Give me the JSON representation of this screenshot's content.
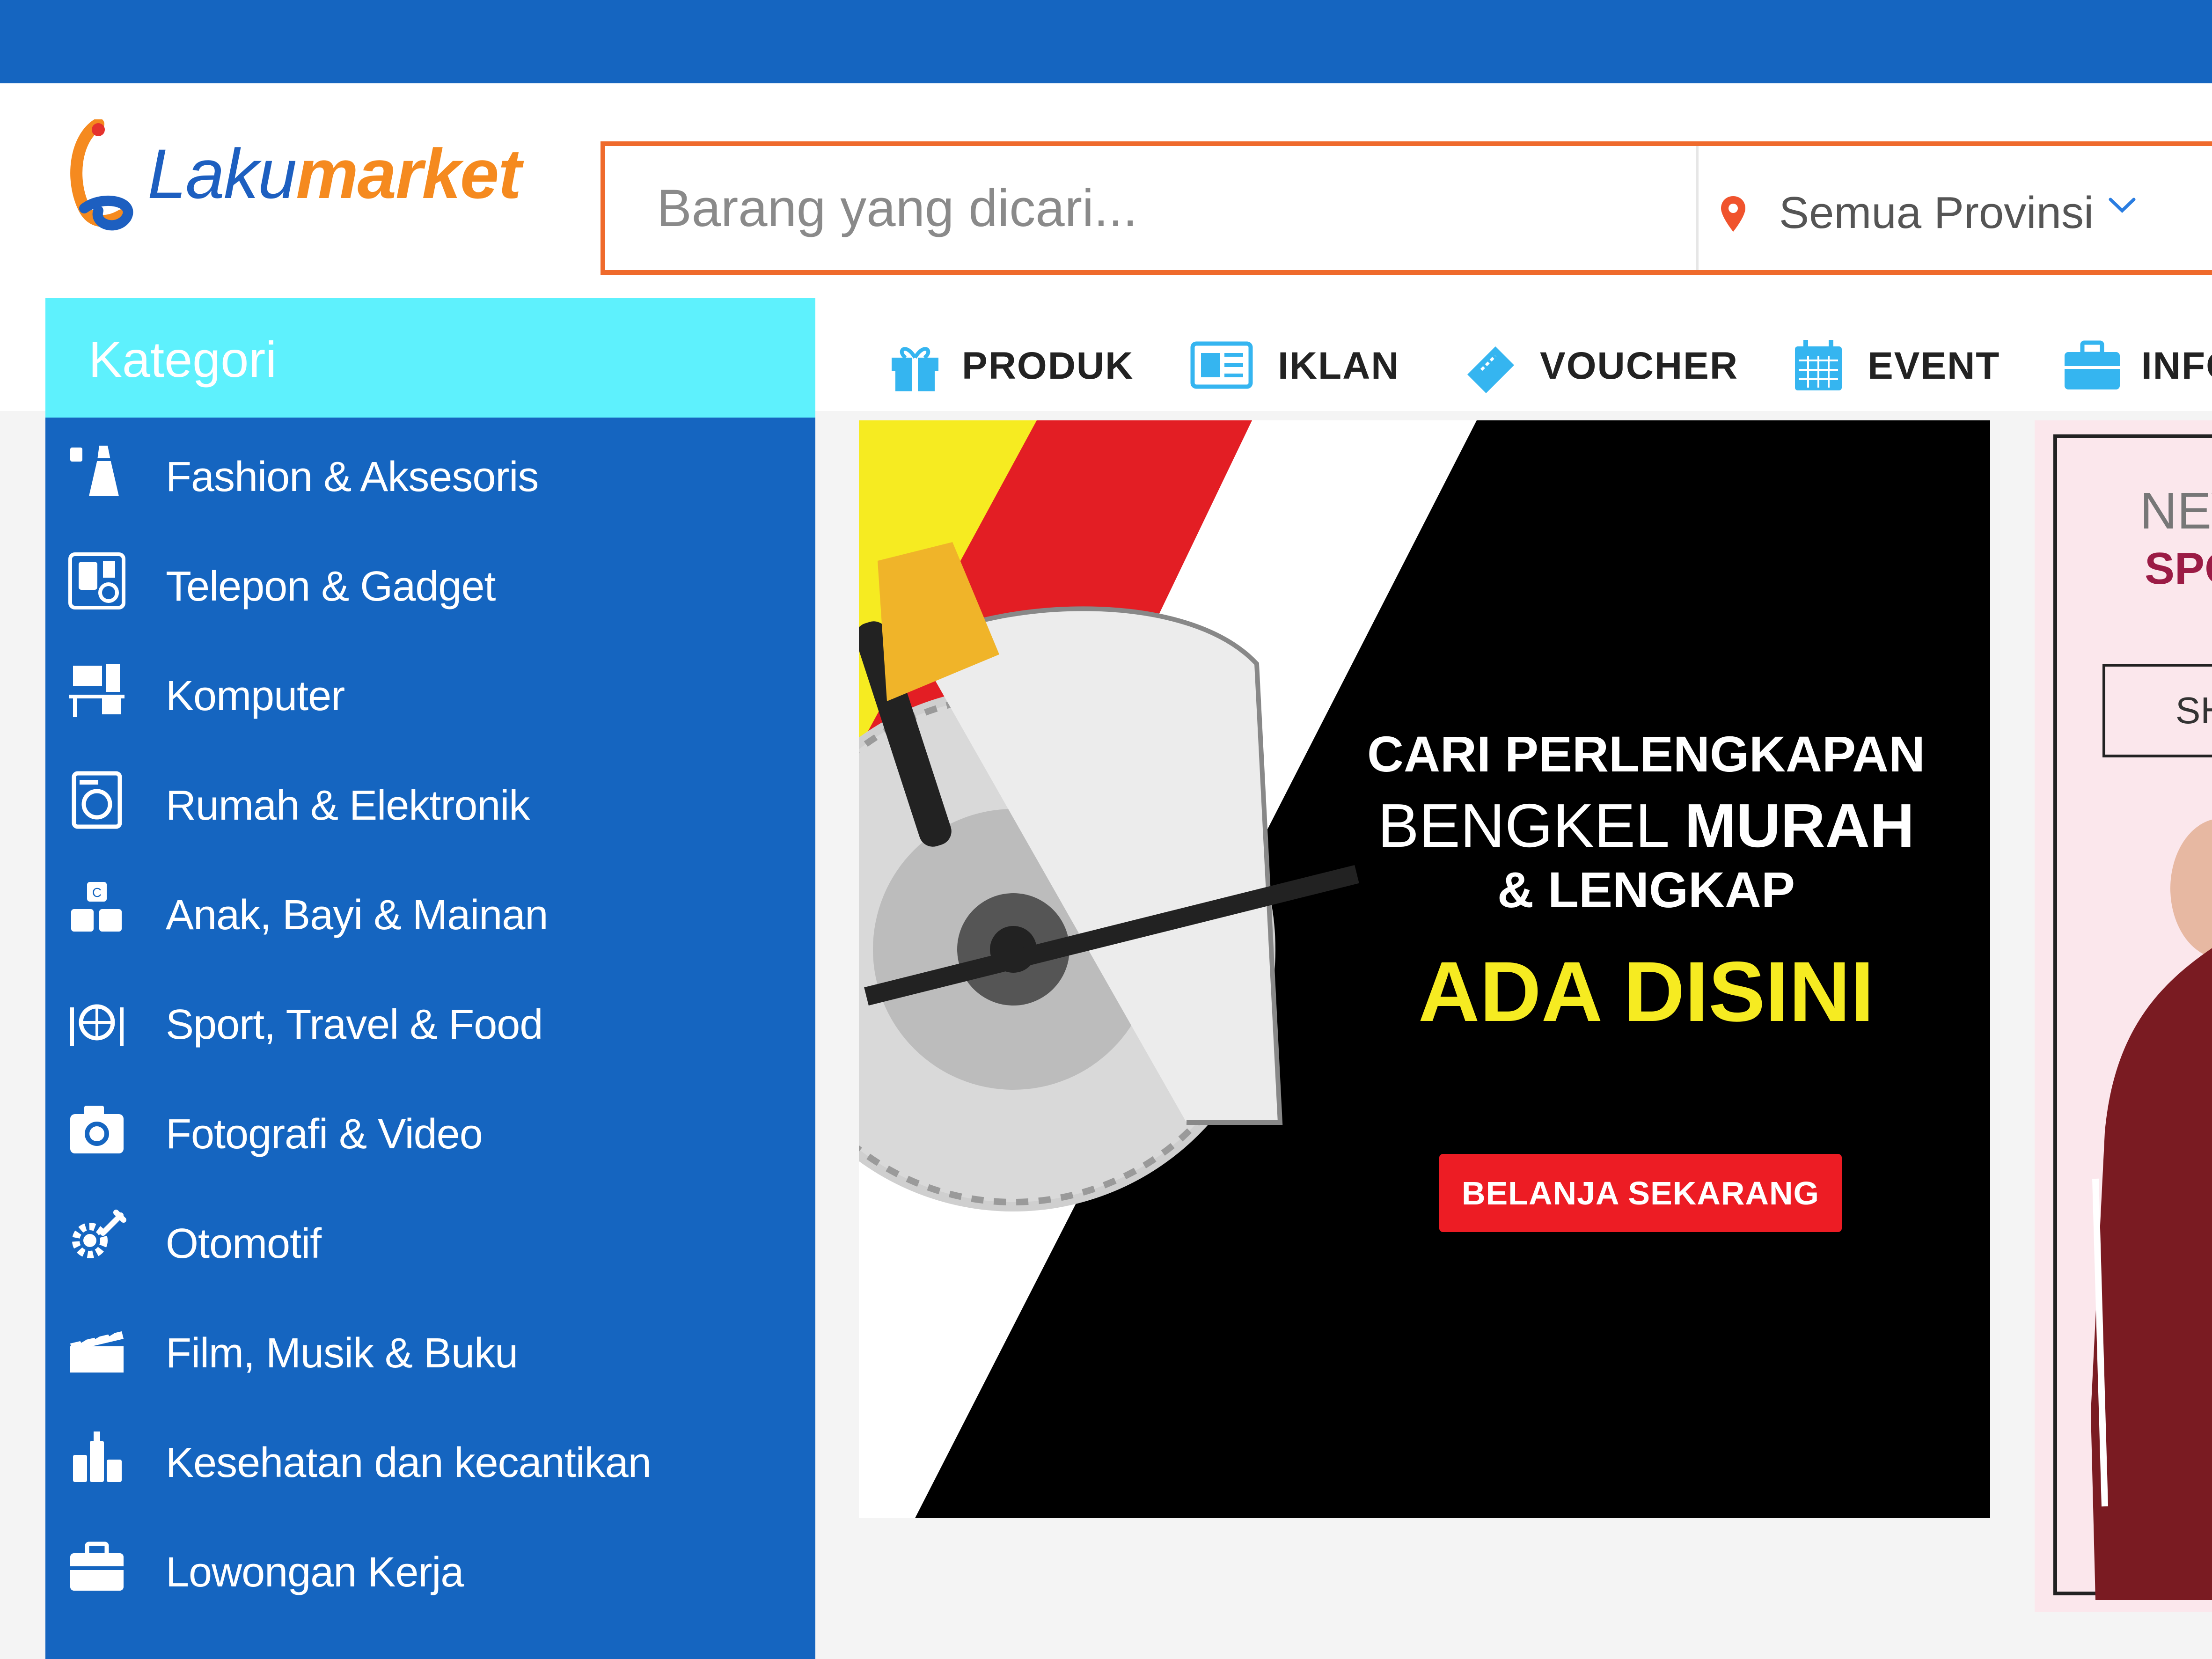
{
  "brand": {
    "logo_part1": "Laku",
    "logo_part2": "market"
  },
  "search": {
    "placeholder": "Barang yang dicari...",
    "province": "Semua Provinsi"
  },
  "sidebar": {
    "title": "Kategori",
    "items": [
      {
        "label": "Fashion & Aksesoris",
        "icon": "fashion-icon"
      },
      {
        "label": "Telepon & Gadget",
        "icon": "phone-icon"
      },
      {
        "label": "Komputer",
        "icon": "computer-icon"
      },
      {
        "label": "Rumah & Elektronik",
        "icon": "appliance-icon"
      },
      {
        "label": "Anak, Bayi & Mainan",
        "icon": "toy-blocks-icon"
      },
      {
        "label": "Sport, Travel & Food",
        "icon": "sport-icon"
      },
      {
        "label": "Fotografi & Video",
        "icon": "camera-icon"
      },
      {
        "label": "Otomotif",
        "icon": "gear-wrench-icon"
      },
      {
        "label": "Film, Musik & Buku",
        "icon": "clapperboard-icon"
      },
      {
        "label": "Kesehatan dan kecantikan",
        "icon": "beauty-icon"
      },
      {
        "label": "Lowongan Kerja",
        "icon": "briefcase-icon"
      }
    ]
  },
  "nav": {
    "tabs": [
      {
        "label": "PRODUK",
        "icon": "gift-icon"
      },
      {
        "label": "IKLAN",
        "icon": "newspaper-icon"
      },
      {
        "label": "VOUCHER",
        "icon": "ticket-icon"
      },
      {
        "label": "EVENT",
        "icon": "calendar-icon"
      },
      {
        "label": "INFO",
        "icon": "briefcase-icon"
      }
    ]
  },
  "banner": {
    "line1": "CARI PERLENGKAPAN",
    "line2_regular": "BENGKEL ",
    "line2_bold": "MURAH",
    "line3": "& LENGKAP",
    "line4": "ADA DISINI",
    "cta": "BELANJA SEKARANG"
  },
  "promo": {
    "line1": "NEW",
    "line2": "SPO",
    "button": "SH"
  },
  "colors": {
    "topbar": "#1565c0",
    "sidebar": "#1565c0",
    "sidebar_header": "#5ef1fd",
    "search_border": "#ef6a2c",
    "nav_icon": "#35b5f0",
    "cta": "#ed1c24",
    "headline_yellow": "#f6eb21"
  }
}
